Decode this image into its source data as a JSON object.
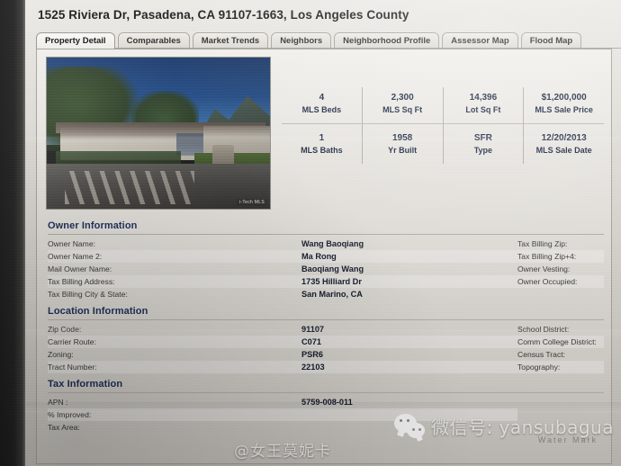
{
  "header": {
    "title": "1525 Riviera Dr, Pasadena, CA 91107-1663, Los Angeles County"
  },
  "tabs": [
    {
      "label": "Property Detail",
      "active": true
    },
    {
      "label": "Comparables",
      "active": false
    },
    {
      "label": "Market Trends",
      "active": false
    },
    {
      "label": "Neighbors",
      "active": false
    },
    {
      "label": "Neighborhood Profile",
      "active": false
    },
    {
      "label": "Assessor Map",
      "active": false
    },
    {
      "label": "Flood Map",
      "active": false
    }
  ],
  "photo": {
    "alt": "Front exterior photo of single-story ranch house with mountains behind",
    "credit": "i-Tech MLS"
  },
  "stats": {
    "row1": [
      {
        "value": "4",
        "label": "MLS Beds"
      },
      {
        "value": "2,300",
        "label": "MLS Sq Ft"
      },
      {
        "value": "14,396",
        "label": "Lot Sq Ft"
      },
      {
        "value": "$1,200,000",
        "label": "MLS Sale Price"
      }
    ],
    "row2": [
      {
        "value": "1",
        "label": "MLS Baths"
      },
      {
        "value": "1958",
        "label": "Yr Built"
      },
      {
        "value": "SFR",
        "label": "Type"
      },
      {
        "value": "12/20/2013",
        "label": "MLS Sale Date"
      }
    ]
  },
  "sections": [
    {
      "title": "Owner Information",
      "left_labels": [
        "Owner Name:",
        "Owner Name 2:",
        "Mail Owner Name:",
        "Tax Billing Address:",
        "Tax Billing City & State:"
      ],
      "mid_values": [
        "Wang Baoqiang",
        "Ma Rong",
        "Baoqiang Wang",
        "1735 Hilliard Dr",
        "San Marino, CA"
      ],
      "right_labels": [
        "Tax Billing Zip:",
        "Tax Billing Zip+4:",
        "Owner Vesting:",
        "Owner Occupied:"
      ],
      "right_values": [
        "",
        "",
        "",
        ""
      ]
    },
    {
      "title": "Location Information",
      "left_labels": [
        "Zip Code:",
        "Carrier Route:",
        "Zoning:",
        "Tract Number:"
      ],
      "mid_values": [
        "91107",
        "C071",
        "PSR6",
        "22103"
      ],
      "right_labels": [
        "School District:",
        "Comm College District:",
        "Census Tract:",
        "Topography:"
      ],
      "right_values": [
        "",
        "",
        "",
        ""
      ]
    },
    {
      "title": "Tax Information",
      "left_labels": [
        "APN :",
        "% Improved:",
        "Tax Area:"
      ],
      "mid_values": [
        "5759-008-011",
        "",
        ""
      ],
      "right_labels": [],
      "right_values": []
    }
  ],
  "watermarks": {
    "wechat_icon": "wechat-icon",
    "wechat_text": "微信号: yansubagua",
    "handle": "@女王莫妮卡",
    "faint": "Water  Mark"
  },
  "colors": {
    "section_title": "#1a2d5c",
    "stat_text": "#16243f",
    "panel_border": "#a9a69f",
    "page_bg": "#d7d5d0"
  }
}
